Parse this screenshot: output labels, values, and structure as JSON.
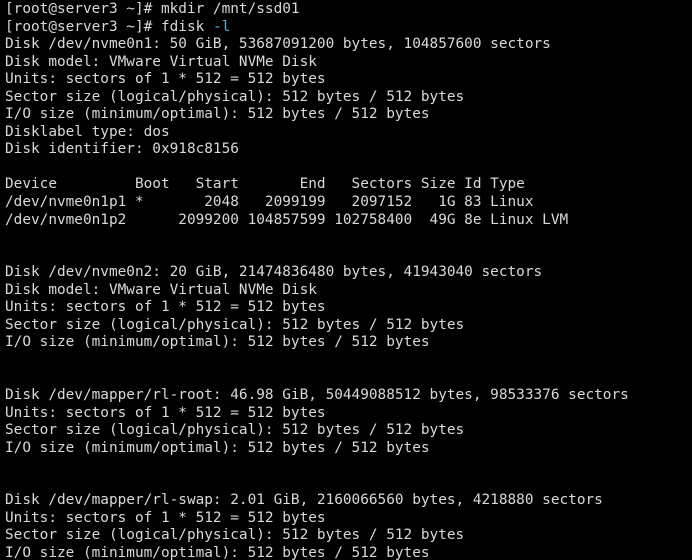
{
  "terminal": {
    "colors": {
      "background": "#000000",
      "foreground": "#d9d9d9",
      "option_highlight": "#5fafd7"
    },
    "lines": [
      [
        {
          "text": "[root@server3 ~]# mkdir /mnt/ssd01"
        }
      ],
      [
        {
          "text": "[root@server3 ~]# fdisk "
        },
        {
          "text": "-l",
          "style": "opt"
        }
      ],
      [
        {
          "text": "Disk /dev/nvme0n1: 50 GiB, 53687091200 bytes, 104857600 sectors"
        }
      ],
      [
        {
          "text": "Disk model: VMware Virtual NVMe Disk"
        }
      ],
      [
        {
          "text": "Units: sectors of 1 * 512 = 512 bytes"
        }
      ],
      [
        {
          "text": "Sector size (logical/physical): 512 bytes / 512 bytes"
        }
      ],
      [
        {
          "text": "I/O size (minimum/optimal): 512 bytes / 512 bytes"
        }
      ],
      [
        {
          "text": "Disklabel type: dos"
        }
      ],
      [
        {
          "text": "Disk identifier: 0x918c8156"
        }
      ],
      [
        {
          "text": ""
        }
      ],
      [
        {
          "text": "Device         Boot   Start       End   Sectors Size Id Type"
        }
      ],
      [
        {
          "text": "/dev/nvme0n1p1 *       2048   2099199   2097152   1G 83 Linux"
        }
      ],
      [
        {
          "text": "/dev/nvme0n1p2      2099200 104857599 102758400  49G 8e Linux LVM"
        }
      ],
      [
        {
          "text": ""
        }
      ],
      [
        {
          "text": ""
        }
      ],
      [
        {
          "text": "Disk /dev/nvme0n2: 20 GiB, 21474836480 bytes, 41943040 sectors"
        }
      ],
      [
        {
          "text": "Disk model: VMware Virtual NVMe Disk"
        }
      ],
      [
        {
          "text": "Units: sectors of 1 * 512 = 512 bytes"
        }
      ],
      [
        {
          "text": "Sector size (logical/physical): 512 bytes / 512 bytes"
        }
      ],
      [
        {
          "text": "I/O size (minimum/optimal): 512 bytes / 512 bytes"
        }
      ],
      [
        {
          "text": ""
        }
      ],
      [
        {
          "text": ""
        }
      ],
      [
        {
          "text": "Disk /dev/mapper/rl-root: 46.98 GiB, 50449088512 bytes, 98533376 sectors"
        }
      ],
      [
        {
          "text": "Units: sectors of 1 * 512 = 512 bytes"
        }
      ],
      [
        {
          "text": "Sector size (logical/physical): 512 bytes / 512 bytes"
        }
      ],
      [
        {
          "text": "I/O size (minimum/optimal): 512 bytes / 512 bytes"
        }
      ],
      [
        {
          "text": ""
        }
      ],
      [
        {
          "text": ""
        }
      ],
      [
        {
          "text": "Disk /dev/mapper/rl-swap: 2.01 GiB, 2160066560 bytes, 4218880 sectors"
        }
      ],
      [
        {
          "text": "Units: sectors of 1 * 512 = 512 bytes"
        }
      ],
      [
        {
          "text": "Sector size (logical/physical): 512 bytes / 512 bytes"
        }
      ],
      [
        {
          "text": "I/O size (minimum/optimal): 512 bytes / 512 bytes"
        }
      ]
    ]
  }
}
